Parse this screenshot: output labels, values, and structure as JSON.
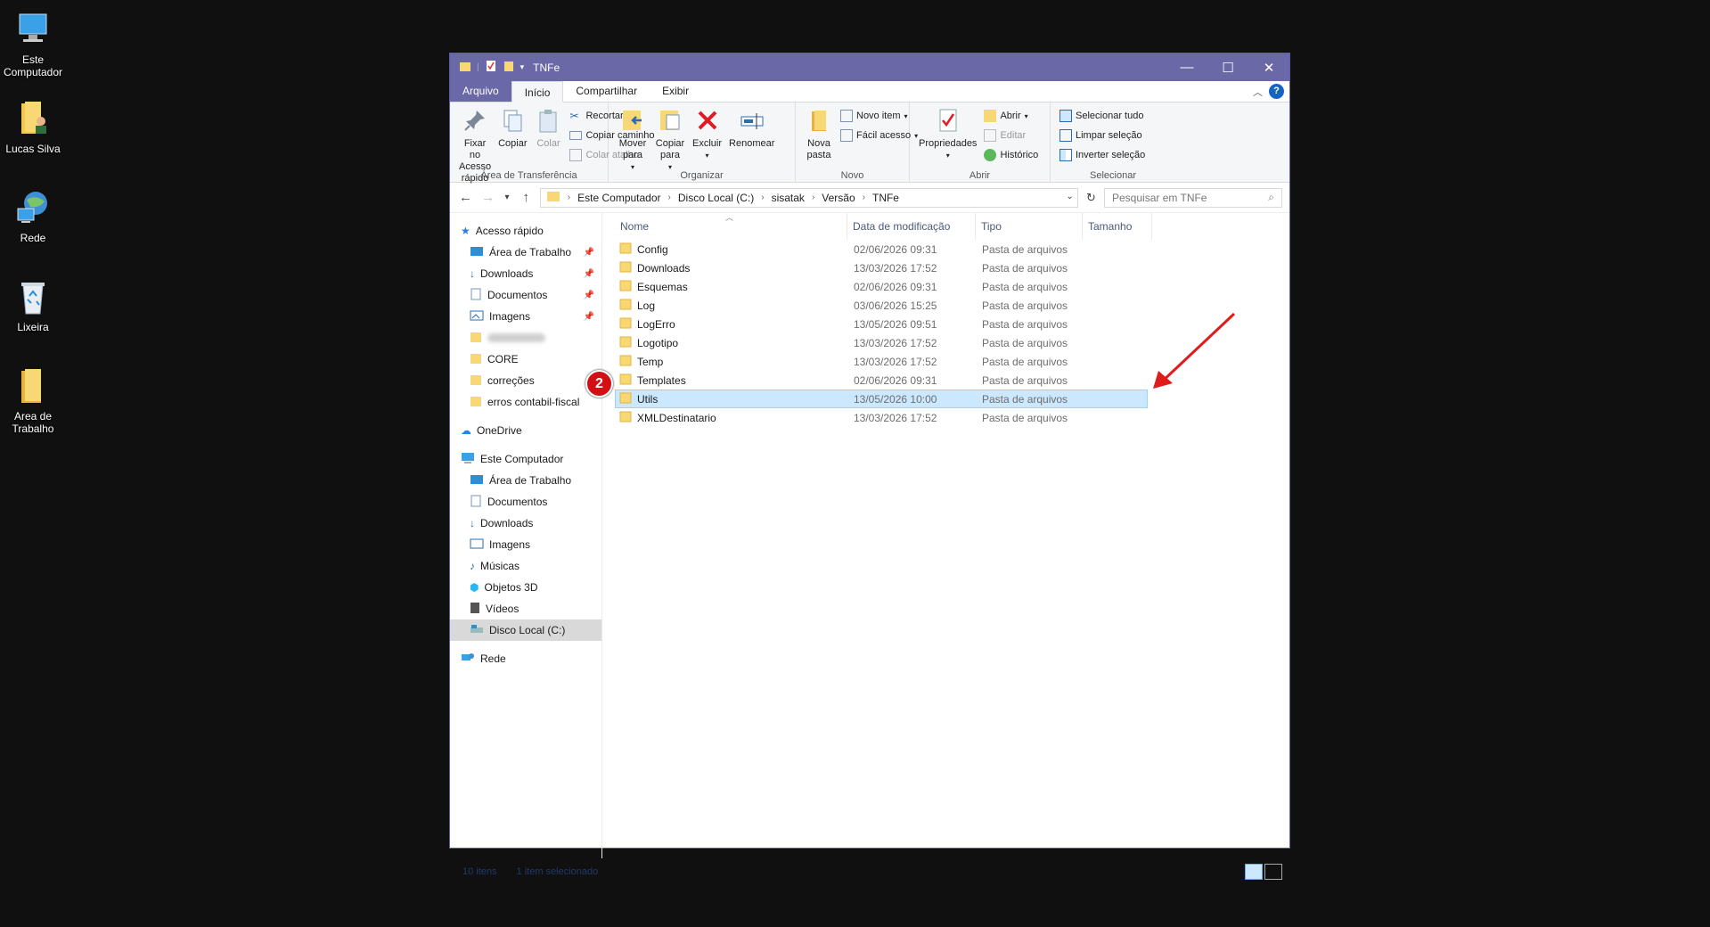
{
  "desktop": {
    "icons": [
      {
        "label": "Este Computador"
      },
      {
        "label": "Lucas Silva"
      },
      {
        "label": "Rede"
      },
      {
        "label": "Lixeira"
      },
      {
        "label": "Area de Trabalho"
      }
    ]
  },
  "window": {
    "title": "TNFe",
    "tabs": {
      "file": "Arquivo",
      "home": "Início",
      "share": "Compartilhar",
      "view": "Exibir"
    },
    "help": "?"
  },
  "ribbon": {
    "clipboard": {
      "pin": "Fixar no Acesso rápido",
      "copy": "Copiar",
      "paste": "Colar",
      "cut": "Recortar",
      "copy_path": "Copiar caminho",
      "paste_shortcut": "Colar atalho",
      "name": "Área de Transferência"
    },
    "organize": {
      "move": "Mover para",
      "copy_to": "Copiar para",
      "delete": "Excluir",
      "rename": "Renomear",
      "name": "Organizar"
    },
    "new": {
      "folder": "Nova pasta",
      "new_item": "Novo item",
      "easy_access": "Fácil acesso",
      "name": "Novo"
    },
    "open": {
      "properties": "Propriedades",
      "open": "Abrir",
      "edit": "Editar",
      "history": "Histórico",
      "name": "Abrir"
    },
    "select": {
      "all": "Selecionar tudo",
      "none": "Limpar seleção",
      "invert": "Inverter seleção",
      "name": "Selecionar"
    }
  },
  "address": {
    "crumbs": [
      "Este Computador",
      "Disco Local (C:)",
      "sisatak",
      "Versão",
      "TNFe"
    ],
    "search_placeholder": "Pesquisar em TNFe"
  },
  "nav": {
    "quick_access": "Acesso rápido",
    "quick_items": [
      {
        "label": "Área de Trabalho"
      },
      {
        "label": "Downloads"
      },
      {
        "label": "Documentos"
      },
      {
        "label": "Imagens"
      },
      {
        "label": "CORE"
      },
      {
        "label": "correções"
      },
      {
        "label": "erros contabil-fiscal"
      }
    ],
    "onedrive": "OneDrive",
    "this_pc": "Este Computador",
    "pc_items": [
      {
        "label": "Área de Trabalho"
      },
      {
        "label": "Documentos"
      },
      {
        "label": "Downloads"
      },
      {
        "label": "Imagens"
      },
      {
        "label": "Músicas"
      },
      {
        "label": "Objetos 3D"
      },
      {
        "label": "Vídeos"
      },
      {
        "label": "Disco Local (C:)"
      }
    ],
    "network": "Rede"
  },
  "columns": {
    "name": "Nome",
    "modified": "Data de modificação",
    "type": "Tipo",
    "size": "Tamanho"
  },
  "files": [
    {
      "name": "Config",
      "modified": "02/06/2026 09:31",
      "type": "Pasta de arquivos"
    },
    {
      "name": "Downloads",
      "modified": "13/03/2026 17:52",
      "type": "Pasta de arquivos"
    },
    {
      "name": "Esquemas",
      "modified": "02/06/2026 09:31",
      "type": "Pasta de arquivos"
    },
    {
      "name": "Log",
      "modified": "03/06/2026 15:25",
      "type": "Pasta de arquivos"
    },
    {
      "name": "LogErro",
      "modified": "13/05/2026 09:51",
      "type": "Pasta de arquivos"
    },
    {
      "name": "Logotipo",
      "modified": "13/03/2026 17:52",
      "type": "Pasta de arquivos"
    },
    {
      "name": "Temp",
      "modified": "13/03/2026 17:52",
      "type": "Pasta de arquivos"
    },
    {
      "name": "Templates",
      "modified": "02/06/2026 09:31",
      "type": "Pasta de arquivos"
    },
    {
      "name": "Utils",
      "modified": "13/05/2026 10:00",
      "type": "Pasta de arquivos"
    },
    {
      "name": "XMLDestinatario",
      "modified": "13/03/2026 17:52",
      "type": "Pasta de arquivos"
    }
  ],
  "selected_index": 8,
  "status": {
    "count": "10 itens",
    "selection": "1 item selecionado"
  },
  "annotation": {
    "badge": "2",
    "badge_color": "#d40f14",
    "arrow_color": "#e01b1b"
  },
  "colors": {
    "title_bar": "#6b68a8",
    "selection": "#cce8ff",
    "folder": "#f8d775"
  }
}
